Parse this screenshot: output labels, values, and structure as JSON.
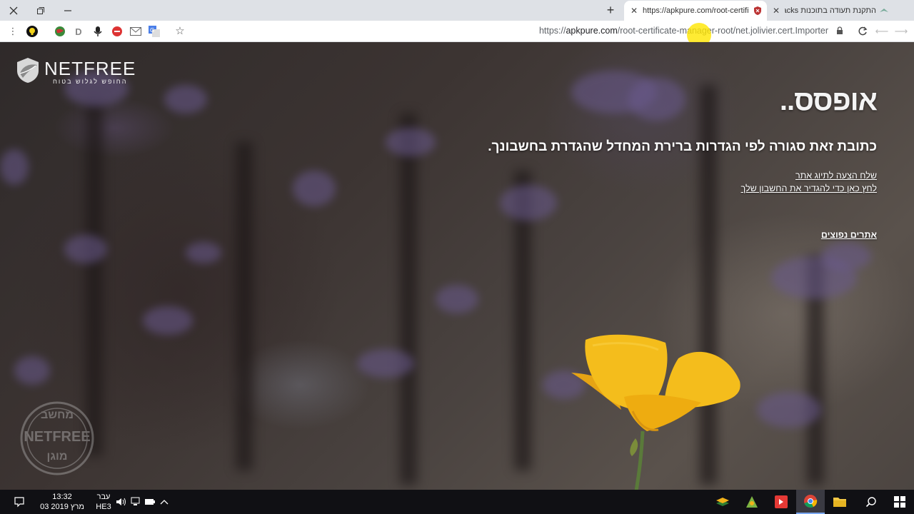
{
  "browser": {
    "tabs": [
      {
        "title": "https://apkpure.com/root-certific",
        "active": true
      },
      {
        "title": "התקנת תעודה בתוכנות BlueStacks",
        "active": false
      }
    ],
    "new_tab_label": "+",
    "url": {
      "prefix": "https://",
      "host": "apkpure.com",
      "path": "/root-certificate-manager-root/net.jolivier.cert.Importer"
    }
  },
  "page": {
    "logo": {
      "name": "NETFREE",
      "tagline": "החופש לגלוש בטוח"
    },
    "heading": "אופסס..",
    "message": "כתובת זאת סגורה לפי הגדרות ברירת המחדל שהגדרת בחשבונך.",
    "links": [
      {
        "label": "שלח הצעה לתיוג אתר"
      },
      {
        "label": "לחץ כאן כדי להגדיר את החשבון שלך"
      }
    ],
    "popular_sites": "אתרים נפוצים",
    "stamp": {
      "top": "מחשב",
      "middle": "NETFREE",
      "bottom": "מוגן"
    }
  },
  "taskbar": {
    "time": "13:32",
    "date": "03 מרץ 2019",
    "language": "עבר",
    "layout": "HE3"
  },
  "colors": {
    "tabstrip": "#dee1e6",
    "flower": "#f2b21a",
    "accent_cursor": "#ffe600"
  }
}
